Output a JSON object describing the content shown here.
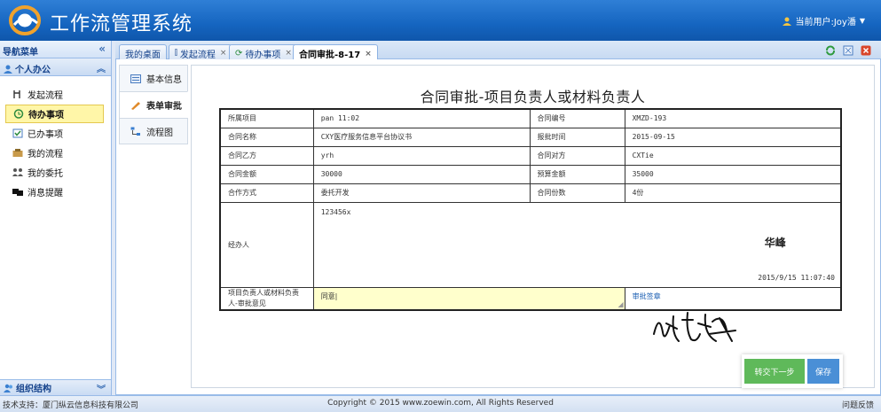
{
  "app": {
    "title": "工作流管理系统",
    "current_user": "当前用户:Joy潘"
  },
  "nav": {
    "header": "导航菜单",
    "group": "个人办公",
    "items": [
      {
        "label": "发起流程",
        "icon": "branch-icon"
      },
      {
        "label": "待办事项",
        "icon": "todo-icon",
        "active": true
      },
      {
        "label": "已办事项",
        "icon": "done-icon"
      },
      {
        "label": "我的流程",
        "icon": "process-icon"
      },
      {
        "label": "我的委托",
        "icon": "delegate-icon"
      },
      {
        "label": "消息提醒",
        "icon": "message-icon"
      }
    ],
    "bottom_group": "组织结构"
  },
  "tabs": [
    {
      "label": "我的桌面",
      "closable": false
    },
    {
      "label": "发起流程",
      "closable": true
    },
    {
      "label": "待办事项",
      "closable": true
    },
    {
      "label": "合同审批-8-17",
      "closable": true,
      "active": true
    }
  ],
  "side_tabs": [
    {
      "label": "基本信息"
    },
    {
      "label": "表单审批",
      "active": true
    },
    {
      "label": "流程图"
    }
  ],
  "form": {
    "title": "合同审批-项目负责人或材料负责人",
    "rows": [
      {
        "l1": "所属项目",
        "v1": "pan 11:02",
        "l2": "合同编号",
        "v2": "XMZD-193"
      },
      {
        "l1": "合同名称",
        "v1": "CXY医疗服务信息平台协议书",
        "l2": "报批时间",
        "v2": "2015-09-15"
      },
      {
        "l1": "合同乙方",
        "v1": "yrh",
        "l2": "合同对方",
        "v2": "CXTie"
      },
      {
        "l1": "合同金额",
        "v1": "30000",
        "l2": "预算金额",
        "v2": "35000"
      },
      {
        "l1": "合作方式",
        "v1": "委托开发",
        "l2": "合同份数",
        "v2": "4份"
      }
    ],
    "handler": {
      "label": "经办人",
      "note": "123456x",
      "name": "华峰",
      "time": "2015/9/15 11:07:40"
    },
    "opinion": {
      "label": "项目负责人或材料负责人-审批意见",
      "value": "同意|",
      "sign_link": "审批签章"
    }
  },
  "buttons": {
    "next": "转交下一步",
    "save": "保存"
  },
  "footer": {
    "left": "技术支持：厦门纵云信息科技有限公司",
    "center": "Copyright © 2015 www.zoewin.com, All Rights Reserved",
    "right": "问题反馈"
  },
  "colors": {
    "header": "#1565c0",
    "active_nav": "#fff6a8",
    "opinion_bg": "#ffffcc",
    "btn_next": "#5fb95a",
    "btn_save": "#4a8fd6"
  }
}
